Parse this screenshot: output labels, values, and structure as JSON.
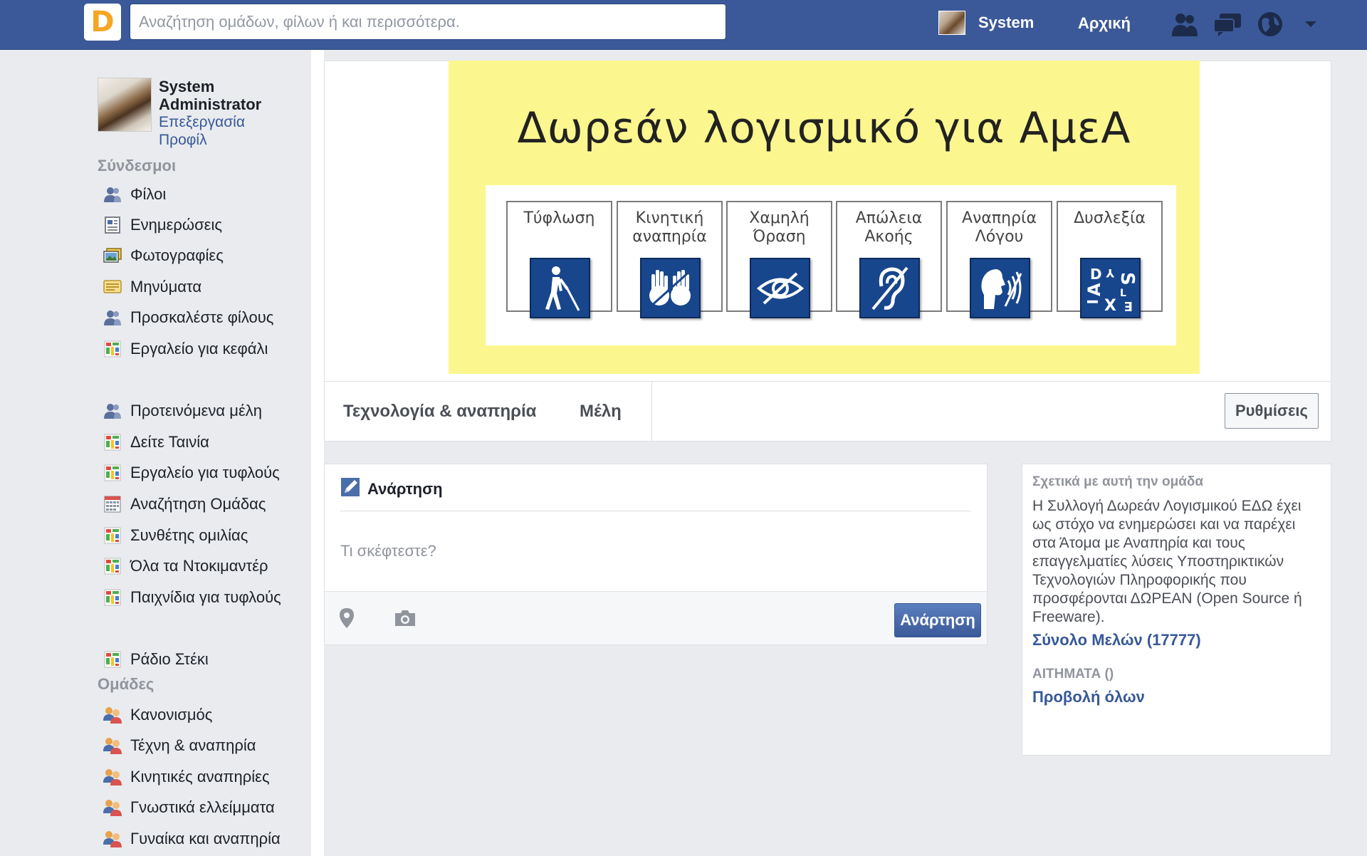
{
  "header": {
    "logo_letter": "D",
    "search_placeholder": "Αναζήτηση ομάδων, φίλων ή και περισσότερα.",
    "user_name": "System",
    "home_label": "Αρχική",
    "icons": [
      "friends-icon",
      "messages-icon",
      "notifications-globe-icon",
      "account-menu-chevron-icon"
    ],
    "bar_color": "#3b5998"
  },
  "profile": {
    "name": "System Administrator",
    "edit_label": "Επεξεργασία Προφίλ"
  },
  "sidebar": {
    "links_title": "Σύνδεσμοι",
    "links": [
      {
        "label": "Φίλοι",
        "icon": "friends-icon"
      },
      {
        "label": "Ενημερώσεις",
        "icon": "news-feed-icon"
      },
      {
        "label": "Φωτογραφίες",
        "icon": "photos-icon"
      },
      {
        "label": "Μηνύματα",
        "icon": "messages-icon"
      },
      {
        "label": "Προσκαλέστε φίλους",
        "icon": "invite-friends-icon"
      },
      {
        "label": "Εργαλείο για κεφάλι",
        "icon": "app-icon"
      }
    ],
    "apps": [
      {
        "label": "Προτεινόμενα μέλη",
        "icon": "suggested-members-icon"
      },
      {
        "label": "Δείτε Ταινία",
        "icon": "app-icon"
      },
      {
        "label": "Εργαλείο για τυφλούς",
        "icon": "app-icon"
      },
      {
        "label": "Αναζήτηση Ομάδας",
        "icon": "calendar-grid-icon"
      },
      {
        "label": "Συνθέτης ομιλίας",
        "icon": "app-icon"
      },
      {
        "label": "Όλα τα Ντοκιμαντέρ",
        "icon": "app-icon"
      },
      {
        "label": "Παιχνίδια για τυφλούς",
        "icon": "app-icon"
      }
    ],
    "extra": [
      {
        "label": "Ράδιο Στέκι",
        "icon": "app-icon"
      }
    ],
    "groups_title": "Ομάδες",
    "groups": [
      {
        "label": "Κανονισμός",
        "icon": "group-icon"
      },
      {
        "label": "Τέχνη & αναπηρία",
        "icon": "group-icon"
      },
      {
        "label": "Κινητικές αναπηρίες",
        "icon": "group-icon"
      },
      {
        "label": "Γνωστικά ελλείμματα",
        "icon": "group-icon"
      },
      {
        "label": "Γυναίκα και αναπηρία",
        "icon": "group-icon"
      }
    ]
  },
  "cover": {
    "title": "Δωρεάν λογισμικό για ΑμεΑ",
    "background": "#fbf78e",
    "cards": [
      {
        "label": "Τύφλωση",
        "icon": "blind-person-icon"
      },
      {
        "label": "Κινητική αναπηρία",
        "icon": "motor-disability-hands-icon"
      },
      {
        "label": "Χαμηλή Όραση",
        "icon": "low-vision-eye-icon"
      },
      {
        "label": "Απώλεια Ακοής",
        "icon": "hearing-loss-ear-icon"
      },
      {
        "label": "Αναπηρία Λόγου",
        "icon": "speech-disability-icon"
      },
      {
        "label": "Δυσλεξία",
        "icon": "dyslexia-letters-icon"
      }
    ],
    "dyslexia_letters": [
      "D",
      "Y",
      "S",
      "L",
      "E",
      "X",
      "I",
      "A"
    ]
  },
  "group_tabs": {
    "tabs": [
      "Τεχνολογία & αναπηρία",
      "Μέλη"
    ],
    "settings_label": "Ρυθμίσεις"
  },
  "composer": {
    "title": "Ανάρτηση",
    "placeholder": "Τι σκέφτεστε?",
    "post_button": "Ανάρτηση",
    "icons": [
      "location-pin-icon",
      "camera-icon"
    ]
  },
  "about": {
    "title": "Σχετικά με αυτή την ομάδα",
    "description": "Η Συλλογή Δωρεάν Λογισμικού ΕΔΩ έχει ως στόχο να ενημερώσει και να παρέχει στα Άτομα με Αναπηρία και τους επαγγελματίες λύσεις Υποστηρικτικών Τεχνολογιών Πληροφορικής που προσφέρονται ΔΩΡΕΑΝ (Open Source ή Freeware).",
    "members_label": "Σύνολο Μελών (17777)",
    "requests_label": "ΑΙΤΗΜΑΤΑ ()",
    "view_all_label": "Προβολή όλων"
  }
}
